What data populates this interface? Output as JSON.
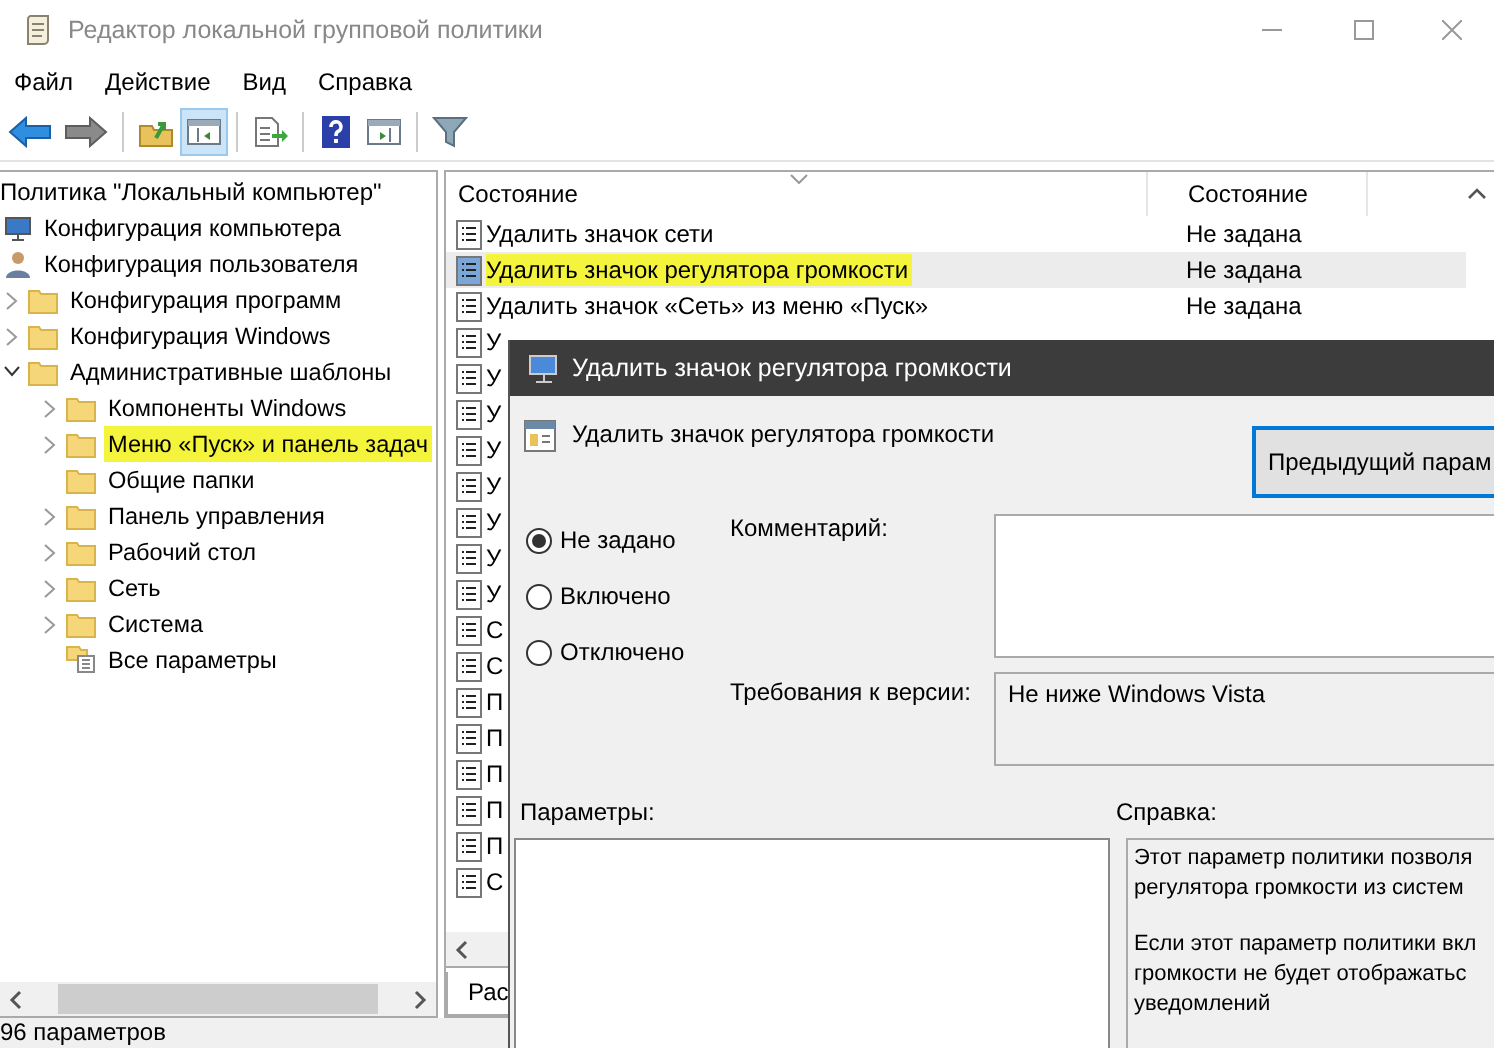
{
  "window": {
    "title": "Редактор локальной групповой политики"
  },
  "menu": [
    "Файл",
    "Действие",
    "Вид",
    "Справка"
  ],
  "toolbar": [
    {
      "kind": "back",
      "pressed": false
    },
    {
      "kind": "forward",
      "pressed": false
    },
    {
      "kind": "separator"
    },
    {
      "kind": "up-folder",
      "pressed": false
    },
    {
      "kind": "tree-toggle",
      "pressed": true
    },
    {
      "kind": "separator"
    },
    {
      "kind": "export",
      "pressed": false
    },
    {
      "kind": "separator"
    },
    {
      "kind": "help",
      "pressed": false
    },
    {
      "kind": "pane",
      "pressed": false
    },
    {
      "kind": "separator"
    },
    {
      "kind": "filter",
      "pressed": false
    }
  ],
  "tree": {
    "root": "Политика \"Локальный компьютер\"",
    "items": [
      {
        "label": "Конфигурация компьютера",
        "kind": "computer",
        "selected": false,
        "highlighted": false
      },
      {
        "label": "Конфигурация пользователя",
        "kind": "user",
        "selected": false,
        "highlighted": false,
        "children": [
          {
            "label": "Конфигурация программ",
            "kind": "folder",
            "expanded": false,
            "selected": false,
            "highlighted": false
          },
          {
            "label": "Конфигурация Windows",
            "kind": "folder",
            "expanded": false,
            "selected": false,
            "highlighted": false
          },
          {
            "label": "Административные шаблоны",
            "kind": "folder",
            "expanded": true,
            "selected": false,
            "highlighted": false,
            "children": [
              {
                "label": "Компоненты Windows",
                "kind": "folder",
                "expanded": false,
                "selected": false,
                "highlighted": false
              },
              {
                "label": "Меню «Пуск» и панель задач",
                "kind": "folder",
                "expanded": false,
                "selected": true,
                "highlighted": true
              },
              {
                "label": "Общие папки",
                "kind": "folder",
                "selected": false,
                "highlighted": false
              },
              {
                "label": "Панель управления",
                "kind": "folder",
                "expanded": false,
                "selected": false,
                "highlighted": false
              },
              {
                "label": "Рабочий стол",
                "kind": "folder",
                "expanded": false,
                "selected": false,
                "highlighted": false
              },
              {
                "label": "Сеть",
                "kind": "folder",
                "expanded": false,
                "selected": false,
                "highlighted": false
              },
              {
                "label": "Система",
                "kind": "folder",
                "expanded": false,
                "selected": false,
                "highlighted": false
              },
              {
                "label": "Все параметры",
                "kind": "settings",
                "selected": false,
                "highlighted": false
              }
            ]
          }
        ]
      }
    ]
  },
  "list": {
    "columns": [
      "Состояние",
      "Состояние"
    ],
    "rows": [
      {
        "name": "Удалить значок сети",
        "state": "Не задана",
        "selected": false,
        "highlighted": false
      },
      {
        "name": "Удалить значок регулятора громкости",
        "state": "Не задана",
        "selected": true,
        "highlighted": true
      },
      {
        "name": "Удалить значок «Сеть» из меню «Пуск»",
        "state": "Не задана",
        "selected": false,
        "highlighted": false
      },
      {
        "name": "У",
        "selected": false,
        "highlighted": false
      },
      {
        "name": "У",
        "selected": false,
        "highlighted": false
      },
      {
        "name": "У",
        "selected": false,
        "highlighted": false
      },
      {
        "name": "У",
        "selected": false,
        "highlighted": false
      },
      {
        "name": "У",
        "selected": false,
        "highlighted": false
      },
      {
        "name": "У",
        "selected": false,
        "highlighted": false
      },
      {
        "name": "У",
        "selected": false,
        "highlighted": false
      },
      {
        "name": "У",
        "selected": false,
        "highlighted": false
      },
      {
        "name": "С",
        "selected": false,
        "highlighted": false
      },
      {
        "name": "С",
        "selected": false,
        "highlighted": false
      },
      {
        "name": "П",
        "selected": false,
        "highlighted": false
      },
      {
        "name": "П",
        "selected": false,
        "highlighted": false
      },
      {
        "name": "П",
        "selected": false,
        "highlighted": false
      },
      {
        "name": "П",
        "selected": false,
        "highlighted": false
      },
      {
        "name": "П",
        "selected": false,
        "highlighted": false
      },
      {
        "name": "С",
        "selected": false,
        "highlighted": false
      }
    ],
    "tabs": [
      {
        "label": "Рас",
        "selected": true
      }
    ]
  },
  "dialog": {
    "title": "Удалить значок регулятора громкости",
    "heading": "Удалить значок регулятора громкости",
    "previous_button": "Предыдущий парам",
    "options": [
      {
        "label": "Не задано",
        "selected": true
      },
      {
        "label": "Включено",
        "selected": false
      },
      {
        "label": "Отключено",
        "selected": false
      }
    ],
    "comment_label": "Комментарий:",
    "requirements_label": "Требования к версии:",
    "requirements": "Не ниже Windows Vista",
    "parameters_label": "Параметры:",
    "help_label": "Справка:",
    "help": [
      [
        "Этот параметр политики позволя",
        "регулятора громкости из систем"
      ],
      [
        "Если этот параметр политики вкл",
        "громкости не будет отображатьс",
        "уведомлений"
      ]
    ]
  },
  "status_bar": "96 параметров"
}
